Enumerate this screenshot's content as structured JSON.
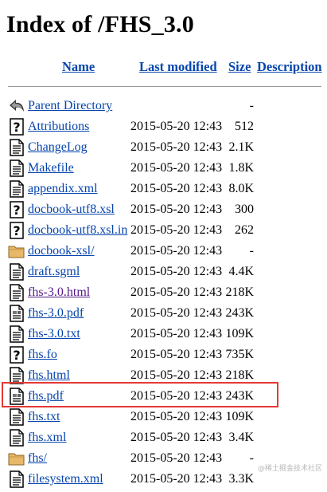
{
  "page": {
    "title": "Index of /FHS_3.0"
  },
  "columns": {
    "name": "Name",
    "modified": "Last modified",
    "size": "Size",
    "description": "Description"
  },
  "rows": [
    {
      "name": "Parent Directory",
      "modified": "",
      "size": "-",
      "icon": "back-icon"
    },
    {
      "name": "Attributions",
      "modified": "2015-05-20 12:43",
      "size": "512",
      "icon": "unknown-file-icon"
    },
    {
      "name": "ChangeLog",
      "modified": "2015-05-20 12:43",
      "size": "2.1K",
      "icon": "text-file-icon"
    },
    {
      "name": "Makefile",
      "modified": "2015-05-20 12:43",
      "size": "1.8K",
      "icon": "text-file-icon"
    },
    {
      "name": "appendix.xml",
      "modified": "2015-05-20 12:43",
      "size": "8.0K",
      "icon": "text-file-icon"
    },
    {
      "name": "docbook-utf8.xsl",
      "modified": "2015-05-20 12:43",
      "size": "300",
      "icon": "unknown-file-icon"
    },
    {
      "name": "docbook-utf8.xsl.in",
      "modified": "2015-05-20 12:43",
      "size": "262",
      "icon": "unknown-file-icon"
    },
    {
      "name": "docbook-xsl/",
      "modified": "2015-05-20 12:43",
      "size": "-",
      "icon": "folder-icon"
    },
    {
      "name": "draft.sgml",
      "modified": "2015-05-20 12:43",
      "size": "4.4K",
      "icon": "text-file-icon"
    },
    {
      "name": "fhs-3.0.html",
      "modified": "2015-05-20 12:43",
      "size": "218K",
      "icon": "text-file-icon",
      "visited": true
    },
    {
      "name": "fhs-3.0.pdf",
      "modified": "2015-05-20 12:43",
      "size": "243K",
      "icon": "layout-file-icon"
    },
    {
      "name": "fhs-3.0.txt",
      "modified": "2015-05-20 12:43",
      "size": "109K",
      "icon": "text-file-icon"
    },
    {
      "name": "fhs.fo",
      "modified": "2015-05-20 12:43",
      "size": "735K",
      "icon": "unknown-file-icon"
    },
    {
      "name": "fhs.html",
      "modified": "2015-05-20 12:43",
      "size": "218K",
      "icon": "text-file-icon"
    },
    {
      "name": "fhs.pdf",
      "modified": "2015-05-20 12:43",
      "size": "243K",
      "icon": "layout-file-icon",
      "highlighted": true
    },
    {
      "name": "fhs.txt",
      "modified": "2015-05-20 12:43",
      "size": "109K",
      "icon": "text-file-icon"
    },
    {
      "name": "fhs.xml",
      "modified": "2015-05-20 12:43",
      "size": "3.4K",
      "icon": "text-file-icon"
    },
    {
      "name": "fhs/",
      "modified": "2015-05-20 12:43",
      "size": "-",
      "icon": "folder-icon"
    },
    {
      "name": "filesystem.xml",
      "modified": "2015-05-20 12:43",
      "size": "3.3K",
      "icon": "text-file-icon"
    }
  ],
  "watermark": "@稀土掘金技术社区",
  "colors": {
    "link": "#0645ad",
    "visited": "#551a8b",
    "highlight_border": "#e53935",
    "folder": "#e8b86a"
  }
}
